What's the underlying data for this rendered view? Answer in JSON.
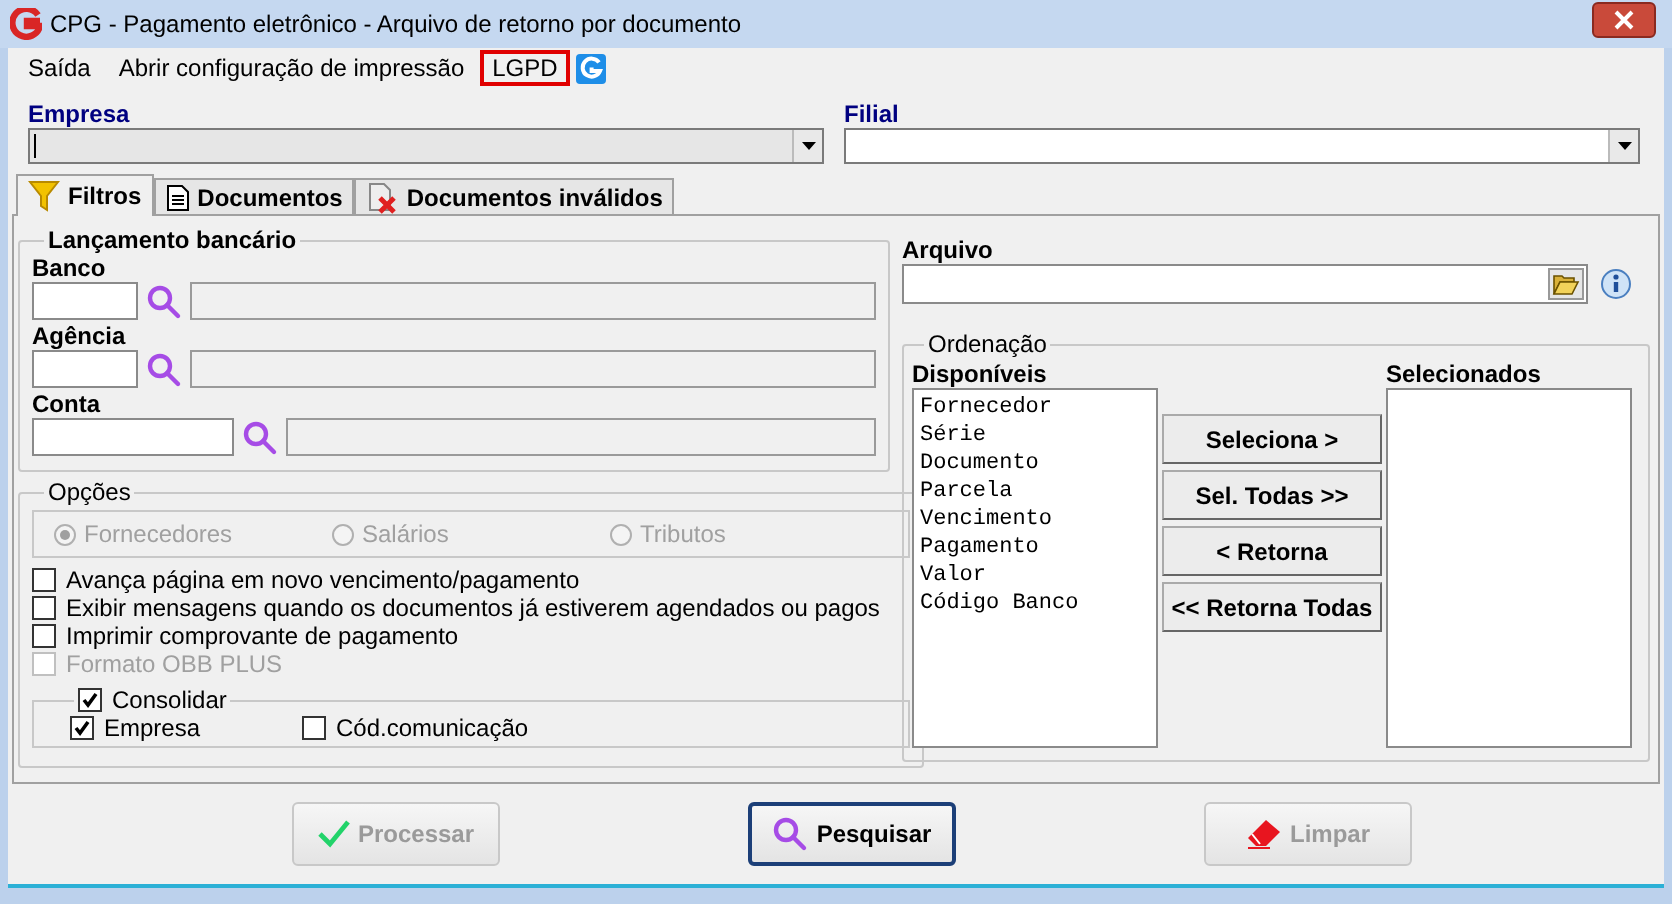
{
  "window": {
    "title": "CPG - Pagamento eletrônico - Arquivo de retorno por documento"
  },
  "menu": [
    {
      "label": "Saída",
      "highlighted": false
    },
    {
      "label": "Abrir configuração de impressão",
      "highlighted": false
    },
    {
      "label": "LGPD",
      "highlighted": true
    }
  ],
  "selectors": [
    {
      "label": "Empresa",
      "disabled": true
    },
    {
      "label": "Filial",
      "disabled": false
    }
  ],
  "tabs": [
    {
      "label": "Filtros",
      "selected": true
    },
    {
      "label": "Documentos",
      "selected": false
    },
    {
      "label": "Documentos inválidos",
      "selected": false
    }
  ],
  "bank_entry": {
    "title": "Lançamento bancário",
    "fields": [
      {
        "label": "Banco",
        "kind": "short"
      },
      {
        "label": "Agência",
        "kind": "short"
      },
      {
        "label": "Conta",
        "kind": "long"
      }
    ]
  },
  "options": {
    "title": "Opções",
    "radios": [
      {
        "label": "Fornecedores",
        "selected": true,
        "disabled": true
      },
      {
        "label": "Salários",
        "selected": false,
        "disabled": true
      },
      {
        "label": "Tributos",
        "selected": false,
        "disabled": true
      }
    ],
    "checkboxes": [
      {
        "label": "Avança página em novo vencimento/pagamento",
        "checked": false,
        "disabled": false
      },
      {
        "label": "Exibir mensagens quando os documentos já estiverem agendados ou pagos",
        "checked": false,
        "disabled": false
      },
      {
        "label": "Imprimir comprovante de pagamento",
        "checked": false,
        "disabled": false
      },
      {
        "label": "Formato OBB PLUS",
        "checked": false,
        "disabled": true
      }
    ],
    "consolidate": {
      "label": "Consolidar",
      "checked": true,
      "children": [
        {
          "label": "Empresa",
          "checked": true
        },
        {
          "label": "Cód.comunicação",
          "checked": false
        }
      ]
    }
  },
  "file": {
    "label": "Arquivo"
  },
  "ordering": {
    "title": "Ordenação",
    "available_label": "Disponíveis",
    "available": [
      "Fornecedor",
      "Série",
      "Documento",
      "Parcela",
      "Vencimento",
      "Pagamento",
      "Valor",
      "Código Banco"
    ],
    "buttons": [
      "Seleciona >",
      "Sel. Todas >>",
      "< Retorna",
      "<< Retorna Todas"
    ],
    "selected_label": "Selecionados"
  },
  "actions": [
    {
      "label": "Processar",
      "kind": "check",
      "disabled": true,
      "focused": false
    },
    {
      "label": "Pesquisar",
      "kind": "search",
      "disabled": false,
      "focused": true
    },
    {
      "label": "Limpar",
      "kind": "eraser",
      "disabled": true,
      "focused": false
    }
  ]
}
